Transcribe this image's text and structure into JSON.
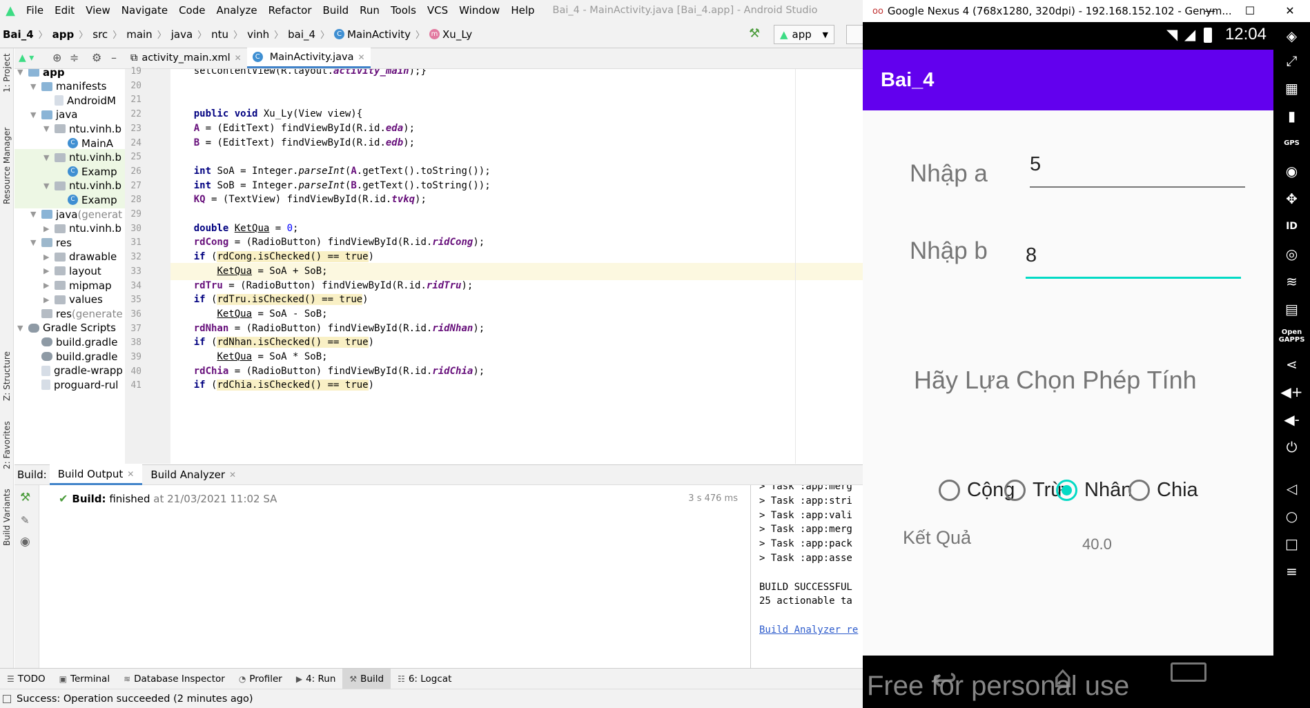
{
  "studio": {
    "window_title": "Bai_4 - MainActivity.java [Bai_4.app] - Android Studio",
    "menu": [
      "File",
      "Edit",
      "View",
      "Navigate",
      "Code",
      "Analyze",
      "Refactor",
      "Build",
      "Run",
      "Tools",
      "VCS",
      "Window",
      "Help"
    ],
    "breadcrumbs": [
      "Bai_4",
      "app",
      "src",
      "main",
      "java",
      "ntu",
      "vinh",
      "bai_4",
      "MainActivity",
      "Xu_Ly"
    ],
    "run_config": "app",
    "tool_windows_left": [
      "1: Project",
      "Resource Manager",
      "Z: Structure",
      "2: Favorites",
      "Build Variants"
    ],
    "project_tree": [
      {
        "label": "app",
        "bold": true,
        "level": 0,
        "arrow": "▼",
        "icon": "folder"
      },
      {
        "label": "manifests",
        "level": 1,
        "arrow": "▼",
        "icon": "folder"
      },
      {
        "label": "AndroidM",
        "level": 2,
        "arrow": "",
        "icon": "file"
      },
      {
        "label": "java",
        "level": 1,
        "arrow": "▼",
        "icon": "folder"
      },
      {
        "label": "ntu.vinh.b",
        "level": 2,
        "arrow": "▼",
        "icon": "folder-grey"
      },
      {
        "label": "MainA",
        "level": 3,
        "arrow": "",
        "icon": "class"
      },
      {
        "label": "ntu.vinh.b",
        "level": 2,
        "arrow": "▼",
        "icon": "folder-grey",
        "highlight": true
      },
      {
        "label": "Examp",
        "level": 3,
        "arrow": "",
        "icon": "class",
        "highlight": true
      },
      {
        "label": "ntu.vinh.b",
        "level": 2,
        "arrow": "▼",
        "icon": "folder-grey",
        "highlight": true
      },
      {
        "label": "Examp",
        "level": 3,
        "arrow": "",
        "icon": "class",
        "highlight": true
      },
      {
        "label": "java",
        "suffix": "(generat",
        "level": 1,
        "arrow": "▼",
        "icon": "folder"
      },
      {
        "label": "ntu.vinh.b",
        "level": 2,
        "arrow": "▶",
        "icon": "folder-grey"
      },
      {
        "label": "res",
        "level": 1,
        "arrow": "▼",
        "icon": "folder-res"
      },
      {
        "label": "drawable",
        "level": 2,
        "arrow": "▶",
        "icon": "folder-grey"
      },
      {
        "label": "layout",
        "level": 2,
        "arrow": "▶",
        "icon": "folder-grey"
      },
      {
        "label": "mipmap",
        "level": 2,
        "arrow": "▶",
        "icon": "folder-grey"
      },
      {
        "label": "values",
        "level": 2,
        "arrow": "▶",
        "icon": "folder-grey"
      },
      {
        "label": "res",
        "suffix": "(generate",
        "level": 1,
        "arrow": "",
        "icon": "folder-grey"
      },
      {
        "label": "Gradle Scripts",
        "level": 0,
        "arrow": "▼",
        "icon": "gradle"
      },
      {
        "label": "build.gradle",
        "level": 1,
        "arrow": "",
        "icon": "gradle"
      },
      {
        "label": "build.gradle",
        "level": 1,
        "arrow": "",
        "icon": "gradle"
      },
      {
        "label": "gradle-wrapp",
        "level": 1,
        "arrow": "",
        "icon": "file"
      },
      {
        "label": "proguard-rul",
        "level": 1,
        "arrow": "",
        "icon": "file"
      }
    ],
    "editor_tabs": [
      {
        "label": "activity_main.xml",
        "active": false
      },
      {
        "label": "MainActivity.java",
        "active": true
      }
    ],
    "code_lines": [
      {
        "n": 19,
        "segs": [
          [
            "",
            "    setContentView(R.layout."
          ],
          [
            "italf",
            "activity_main"
          ],
          [
            "",
            ");}"
          ]
        ]
      },
      {
        "n": 20,
        "segs": []
      },
      {
        "n": 21,
        "segs": []
      },
      {
        "n": 22,
        "segs": [
          [
            "",
            "    "
          ],
          [
            "kw",
            "public void "
          ],
          [
            "",
            "Xu_Ly(View view){"
          ]
        ]
      },
      {
        "n": 23,
        "segs": [
          [
            "",
            "    "
          ],
          [
            "fld",
            "A"
          ],
          [
            "",
            " = (EditText) findViewById(R.id."
          ],
          [
            "italf",
            "eda"
          ],
          [
            "",
            ");"
          ]
        ]
      },
      {
        "n": 24,
        "segs": [
          [
            "",
            "    "
          ],
          [
            "fld",
            "B"
          ],
          [
            "",
            " = (EditText) findViewById(R.id."
          ],
          [
            "italf",
            "edb"
          ],
          [
            "",
            ");"
          ]
        ]
      },
      {
        "n": 25,
        "segs": []
      },
      {
        "n": 26,
        "segs": [
          [
            "",
            "    "
          ],
          [
            "kw",
            "int "
          ],
          [
            "",
            "SoA = Integer."
          ],
          [
            "ital",
            "parseInt"
          ],
          [
            "",
            "("
          ],
          [
            "fld",
            "A"
          ],
          [
            "",
            ".getText().toString());"
          ]
        ]
      },
      {
        "n": 27,
        "segs": [
          [
            "",
            "    "
          ],
          [
            "kw",
            "int "
          ],
          [
            "",
            "SoB = Integer."
          ],
          [
            "ital",
            "parseInt"
          ],
          [
            "",
            "("
          ],
          [
            "fld",
            "B"
          ],
          [
            "",
            ".getText().toString());"
          ]
        ]
      },
      {
        "n": 28,
        "segs": [
          [
            "",
            "    "
          ],
          [
            "fld",
            "KQ"
          ],
          [
            "",
            " = (TextView) findViewById(R.id."
          ],
          [
            "italf",
            "tvkq"
          ],
          [
            "",
            ");"
          ]
        ]
      },
      {
        "n": 29,
        "segs": []
      },
      {
        "n": 30,
        "segs": [
          [
            "",
            "    "
          ],
          [
            "kw",
            "double "
          ],
          [
            "und",
            "KetQua"
          ],
          [
            "",
            " = "
          ],
          [
            "num",
            "0"
          ],
          [
            "",
            ";"
          ]
        ]
      },
      {
        "n": 31,
        "segs": [
          [
            "",
            "    "
          ],
          [
            "fld",
            "rdCong"
          ],
          [
            "",
            " = (RadioButton) findViewById(R.id."
          ],
          [
            "italf",
            "ridCong"
          ],
          [
            "",
            ");"
          ]
        ]
      },
      {
        "n": 32,
        "segs": [
          [
            "",
            "    "
          ],
          [
            "kw",
            "if "
          ],
          [
            "",
            "("
          ],
          [
            "hlb",
            "rdCong.isChecked() == true"
          ],
          [
            "",
            ")"
          ]
        ]
      },
      {
        "n": 33,
        "cur": true,
        "segs": [
          [
            "",
            "        "
          ],
          [
            "und",
            "KetQua"
          ],
          [
            "",
            " = SoA + SoB;"
          ]
        ]
      },
      {
        "n": 34,
        "segs": [
          [
            "",
            "    "
          ],
          [
            "fld",
            "rdTru"
          ],
          [
            "",
            " = (RadioButton) findViewById(R.id."
          ],
          [
            "italf",
            "ridTru"
          ],
          [
            "",
            ");"
          ]
        ]
      },
      {
        "n": 35,
        "segs": [
          [
            "",
            "    "
          ],
          [
            "kw",
            "if "
          ],
          [
            "",
            "("
          ],
          [
            "hlb",
            "rdTru.isChecked() == true"
          ],
          [
            "",
            ")"
          ]
        ]
      },
      {
        "n": 36,
        "segs": [
          [
            "",
            "        "
          ],
          [
            "und",
            "KetQua"
          ],
          [
            "",
            " = SoA - SoB;"
          ]
        ]
      },
      {
        "n": 37,
        "segs": [
          [
            "",
            "    "
          ],
          [
            "fld",
            "rdNhan"
          ],
          [
            "",
            " = (RadioButton) findViewById(R.id."
          ],
          [
            "italf",
            "ridNhan"
          ],
          [
            "",
            ");"
          ]
        ]
      },
      {
        "n": 38,
        "segs": [
          [
            "",
            "    "
          ],
          [
            "kw",
            "if "
          ],
          [
            "",
            "("
          ],
          [
            "hlb",
            "rdNhan.isChecked() == true"
          ],
          [
            "",
            ")"
          ]
        ]
      },
      {
        "n": 39,
        "segs": [
          [
            "",
            "        "
          ],
          [
            "und",
            "KetQua"
          ],
          [
            "",
            " = SoA * SoB;"
          ]
        ]
      },
      {
        "n": 40,
        "segs": [
          [
            "",
            "    "
          ],
          [
            "fld",
            "rdChia"
          ],
          [
            "",
            " = (RadioButton) findViewById(R.id."
          ],
          [
            "italf",
            "ridChia"
          ],
          [
            "",
            ");"
          ]
        ]
      },
      {
        "n": 41,
        "segs": [
          [
            "",
            "    "
          ],
          [
            "kw",
            "if "
          ],
          [
            "",
            "("
          ],
          [
            "hlb",
            "rdChia.isChecked() == true"
          ],
          [
            "",
            ")"
          ]
        ]
      }
    ],
    "build": {
      "label": "Build:",
      "tabs": [
        {
          "label": "Build Output",
          "active": true
        },
        {
          "label": "Build Analyzer",
          "active": false
        }
      ],
      "result_bold": "Build:",
      "result_text": " finished",
      "result_time": "at 21/03/2021 11:02 SA",
      "duration": "3 s 476 ms",
      "output_lines": [
        "> Task :app:merg",
        "> Task :app:stri",
        "> Task :app:vali",
        "> Task :app:merg",
        "> Task :app:pack",
        "> Task :app:asse",
        "",
        "BUILD SUCCESSFUL",
        "25 actionable ta",
        "",
        "Build Analyzer re"
      ]
    },
    "bottom_tools": [
      {
        "label": "TODO",
        "icon": "☰"
      },
      {
        "label": "Terminal",
        "icon": "▣"
      },
      {
        "label": "Database Inspector",
        "icon": "≋"
      },
      {
        "label": "Profiler",
        "icon": "◔"
      },
      {
        "label": "4: Run",
        "icon": "▶"
      },
      {
        "label": "Build",
        "icon": "⚒",
        "active": true
      },
      {
        "label": "6: Logcat",
        "icon": "☷"
      }
    ],
    "status": "Success: Operation succeeded (2 minutes ago)"
  },
  "emulator": {
    "window_title": "Google Nexus 4 (768x1280, 320dpi) - 192.168.152.102 - Genym...",
    "clock": "12:04",
    "app_title": "Bai_4",
    "label_a": "Nhập a",
    "value_a": "5",
    "label_b": "Nhập b",
    "value_b": "8",
    "prompt": "Hãy Lựa Chọn Phép Tính",
    "radios": [
      {
        "label": "Cộng",
        "checked": false
      },
      {
        "label": "Trừ",
        "checked": false
      },
      {
        "label": "Nhân",
        "checked": true
      },
      {
        "label": "Chia",
        "checked": false
      }
    ],
    "result_label": "Kết Quả",
    "result_value": "40.0",
    "watermark": "Free for personal use"
  },
  "colors": {
    "app_bar": "#6200ee",
    "accent": "#03dac5",
    "android_green": "#3ddc84"
  }
}
